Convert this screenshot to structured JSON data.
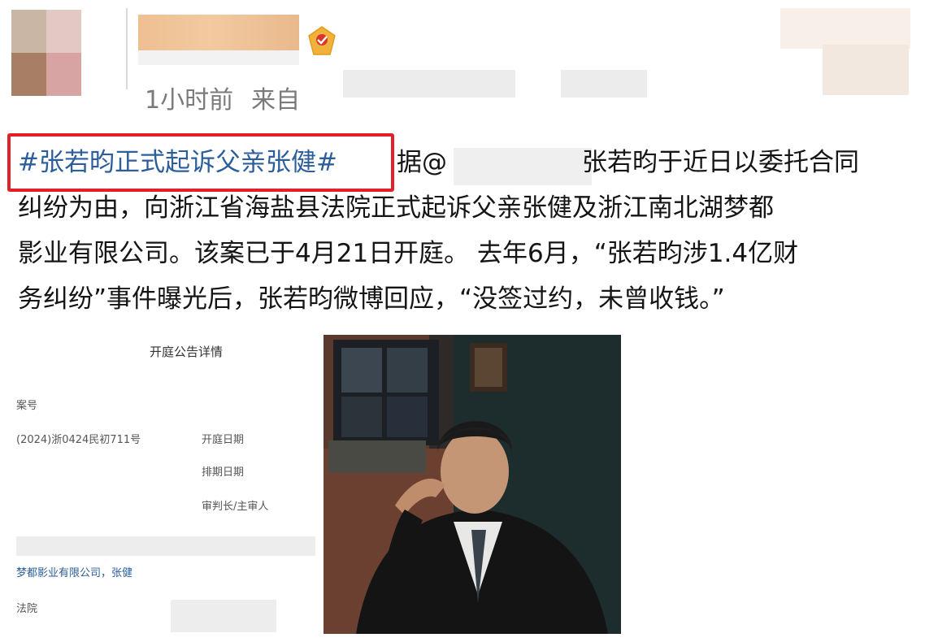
{
  "post": {
    "time": "1小时前",
    "source_prefix": "来自",
    "hashtag": "#张若昀正式起诉父亲张健#",
    "according": "据@",
    "line1_rest": "张若昀于近日以委托合同",
    "line2": "纠纷为由，向浙江省海盐县法院正式起诉父亲张健及浙江南北湖梦都",
    "line3": "影业有限公司。该案已于4月21日开庭。   去年6月，“张若昀涉1.4亿财",
    "line4": "务纠纷”事件曝光后，张若昀微博回应，“没签过约，未曾收钱。”"
  },
  "court_notice": {
    "title": "开庭公告详情",
    "case_label": "案号",
    "case_number": "(2024)浙0424民初711号",
    "hearing_date_label": "开庭日期",
    "schedule_date_label": "排期日期",
    "judge_label": "审判长/主审人",
    "parties": "梦都影业有限公司，张健",
    "court_label": "法院"
  },
  "colors": {
    "hashtag_blue": "#2b5e9b",
    "highlight_red": "#e2202a",
    "meta_gray": "#7a7a7a"
  }
}
